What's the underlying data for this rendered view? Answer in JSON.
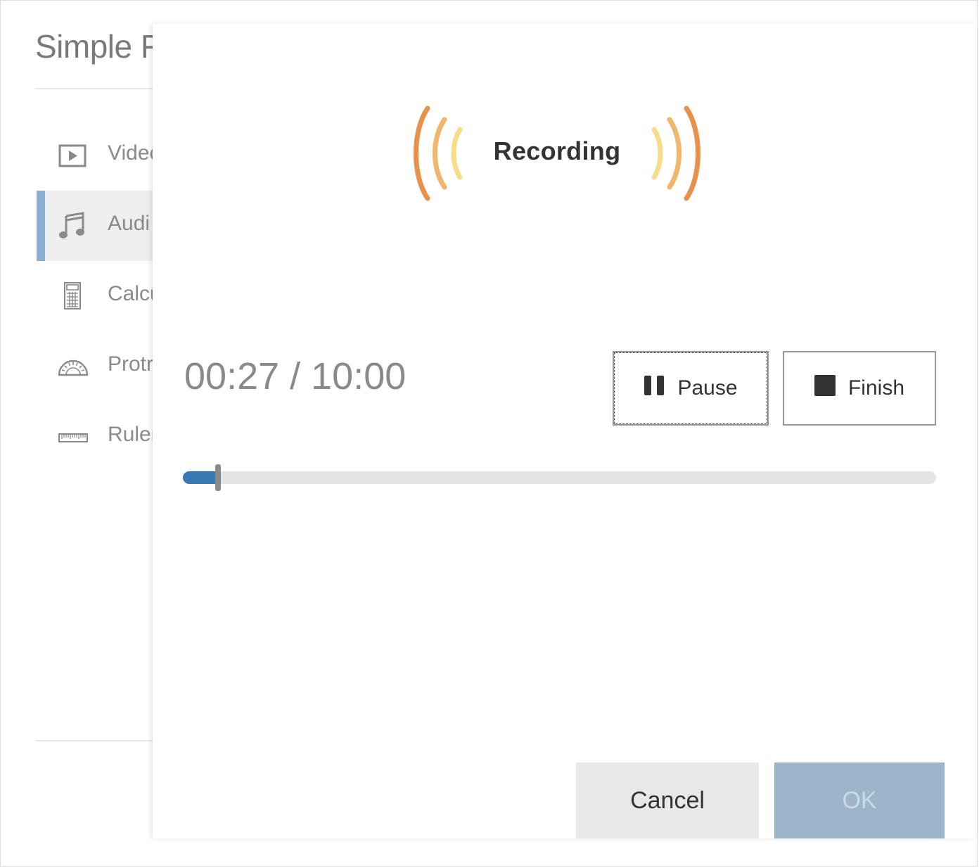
{
  "background_page": {
    "title": "Simple F",
    "nav": [
      {
        "label": "Videc",
        "icon": "video-icon",
        "active": false
      },
      {
        "label": "Audi",
        "icon": "music-note-icon",
        "active": true
      },
      {
        "label": "Calcu",
        "icon": "calculator-icon",
        "active": false
      },
      {
        "label": "Protr",
        "icon": "protractor-icon",
        "active": false
      },
      {
        "label": "Ruler",
        "icon": "ruler-icon",
        "active": false
      }
    ]
  },
  "dialog": {
    "status_label": "Recording",
    "status_icon": "sound-waves-icon",
    "time": {
      "elapsed": "00:27",
      "separator": "/",
      "total": "10:00",
      "display": "00:27 / 10:00"
    },
    "progress": {
      "elapsed_seconds": 27,
      "total_seconds": 600,
      "fraction": 0.045
    },
    "controls": {
      "pause_label": "Pause",
      "pause_icon": "pause-icon",
      "finish_label": "Finish",
      "finish_icon": "stop-icon"
    },
    "footer": {
      "cancel_label": "Cancel",
      "ok_label": "OK",
      "ok_disabled": true
    }
  },
  "colors": {
    "accent": "#3a78b3",
    "nav_active_bar": "#8bb0d3",
    "wave_outer": "#e8914a",
    "wave_middle": "#f0b76a",
    "wave_inner": "#f7dc8a",
    "ok_disabled_bg": "#9cb5ca",
    "cancel_bg": "#e8e8e8"
  }
}
